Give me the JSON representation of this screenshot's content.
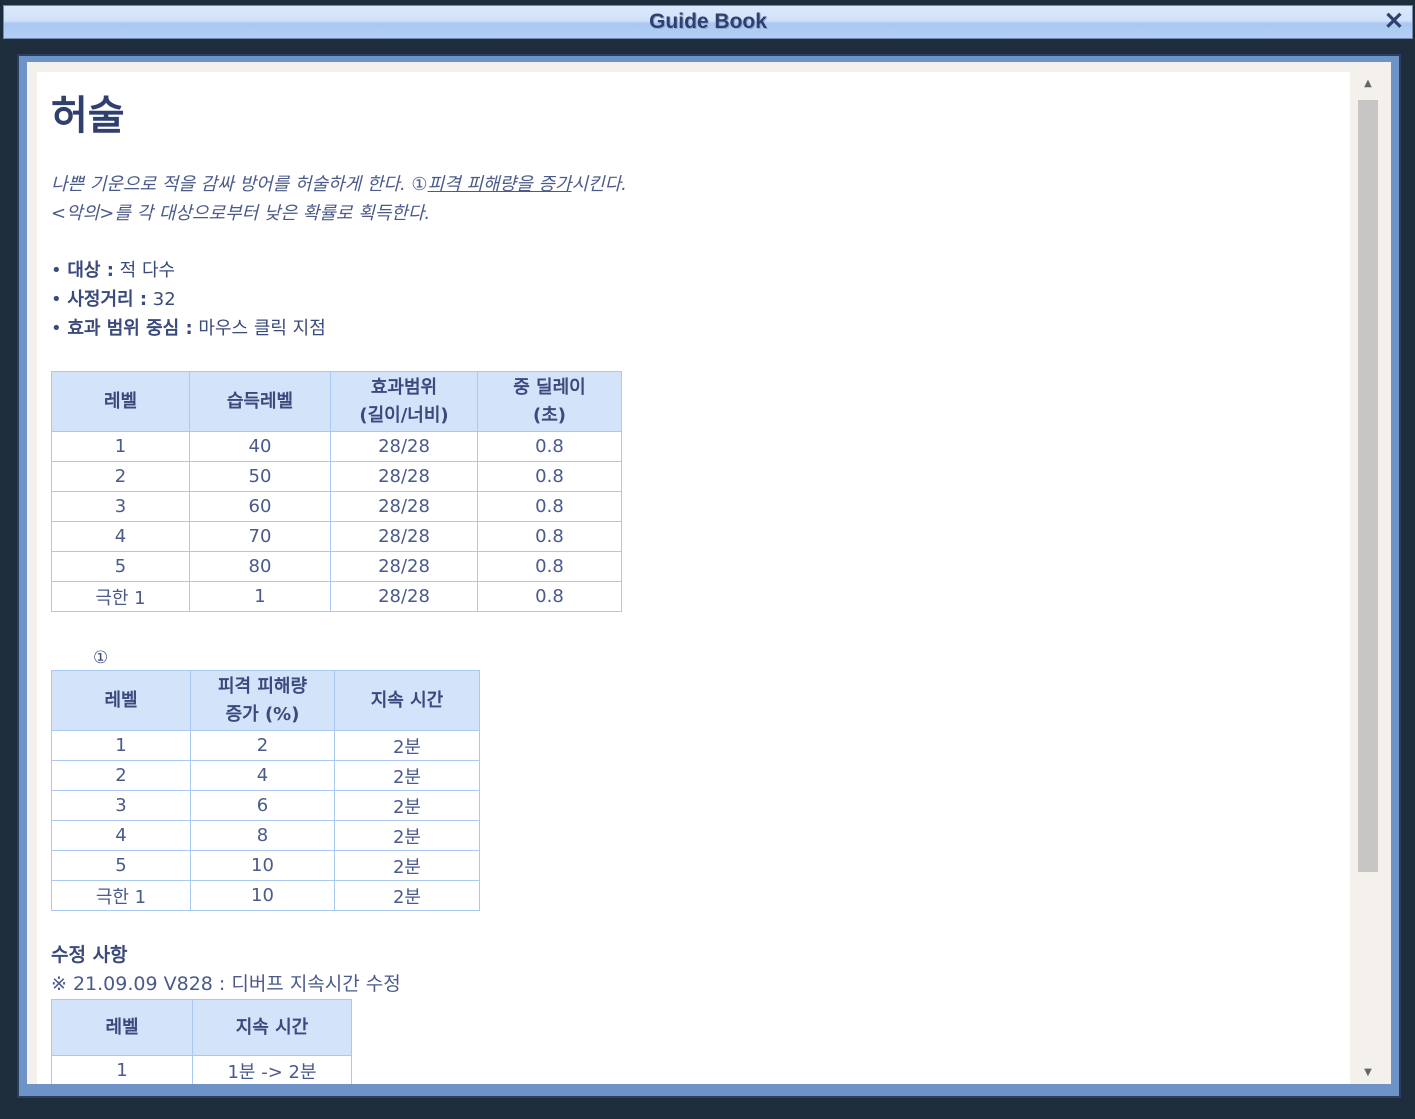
{
  "window": {
    "title": "Guide Book",
    "close": "✕"
  },
  "skill": {
    "name": "허술",
    "desc_line1_a": "나쁜 기운으로 적을 감싸 방어를 허술하게 한다. ①",
    "desc_line1_link": "피격 피해량을 증가",
    "desc_line1_b": "시킨다.",
    "desc_line2": "<악의>를 각 대상으로부터 낮은 확률로 획득한다.",
    "props": [
      {
        "label": "대상 :",
        "value": " 적 다수"
      },
      {
        "label": "사정거리 :",
        "value": " 32"
      },
      {
        "label": "효과 범위 중심 :",
        "value": " 마우스 클릭 지점"
      }
    ]
  },
  "table1": {
    "headers": [
      "레벨",
      "습득레벨",
      "효과범위\n(길이/너비)",
      "중 딜레이\n(초)"
    ],
    "rows": [
      [
        "1",
        "40",
        "28/28",
        "0.8"
      ],
      [
        "2",
        "50",
        "28/28",
        "0.8"
      ],
      [
        "3",
        "60",
        "28/28",
        "0.8"
      ],
      [
        "4",
        "70",
        "28/28",
        "0.8"
      ],
      [
        "5",
        "80",
        "28/28",
        "0.8"
      ],
      [
        "극한 1",
        "1",
        "28/28",
        "0.8"
      ]
    ]
  },
  "table2": {
    "marker": "①",
    "headers": [
      "레벨",
      "피격 피해량\n증가 (%)",
      "지속 시간"
    ],
    "rows": [
      [
        "1",
        "2",
        "2분"
      ],
      [
        "2",
        "4",
        "2분"
      ],
      [
        "3",
        "6",
        "2분"
      ],
      [
        "4",
        "8",
        "2분"
      ],
      [
        "5",
        "10",
        "2분"
      ],
      [
        "극한 1",
        "10",
        "2분"
      ]
    ]
  },
  "changes": {
    "title": "수정 사항",
    "note": "※ 21.09.09 V828 : 디버프 지속시간 수정",
    "headers": [
      "레벨",
      "지속 시간"
    ],
    "rows": [
      [
        "1",
        "1분 -> 2분"
      ]
    ]
  }
}
